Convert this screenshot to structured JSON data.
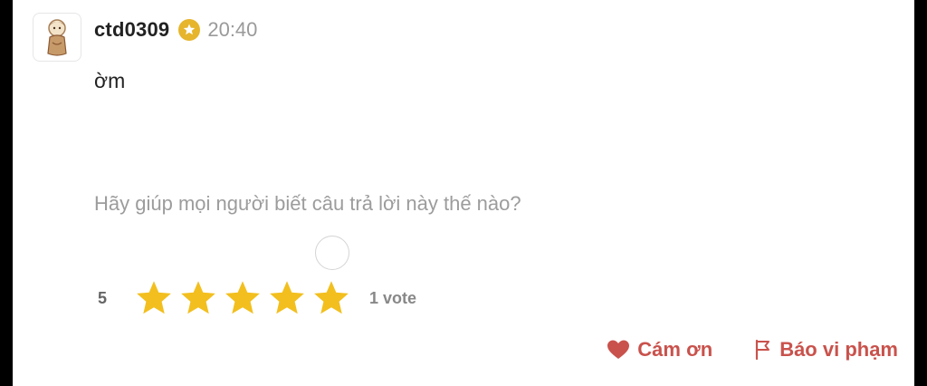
{
  "answer": {
    "username": "ctd0309",
    "time": "20:40",
    "text": "ờm",
    "icons": {
      "avatar": "user-avatar-character",
      "badge": "verified-badge-icon"
    }
  },
  "feedback": {
    "prompt": "Hãy giúp mọi người biết câu trả lời này thế nào?"
  },
  "rating": {
    "value": "5",
    "stars_filled": 5,
    "stars_total": 5,
    "votes_label": "1 vote",
    "star_color": "#f2bf1e"
  },
  "actions": {
    "thanks_label": "Cám ơn",
    "report_label": "Báo vi phạm",
    "accent_color": "#c9524c"
  }
}
